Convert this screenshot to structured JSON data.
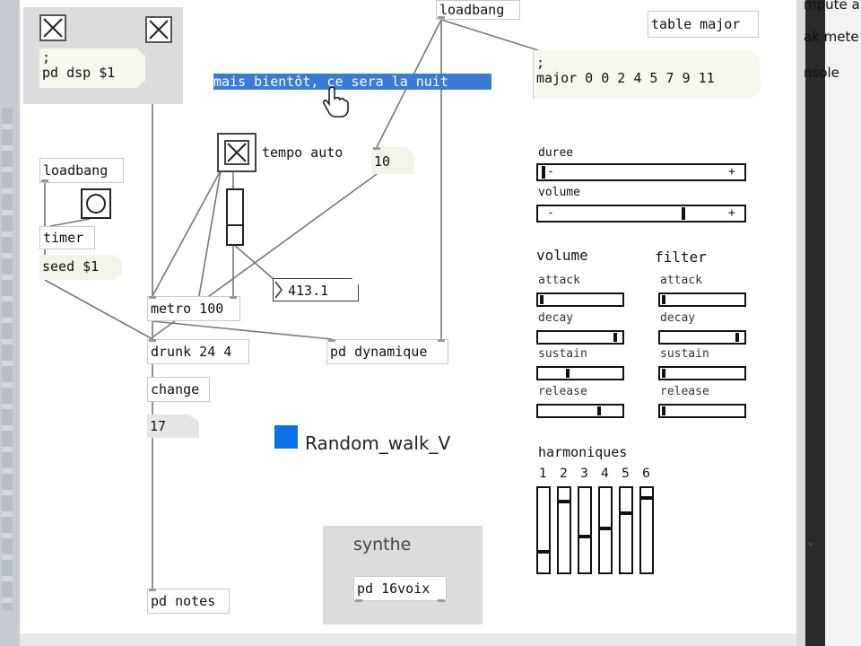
{
  "right_panel": {
    "items": [
      "mpute a",
      "ak mete",
      "nsole"
    ],
    "caret": "⌄"
  },
  "objects": {
    "loadbang_top": "loadbang",
    "table_major": "table major",
    "pd_dsp_msg": ";\npd dsp $1",
    "major_msg": ";\nmajor 0 0 2 4 5 7 9 11",
    "comment_selected": "mais bientôt, ce sera la nuit",
    "tempo_label": "tempo auto",
    "number_10": "10",
    "loadbang_left": "loadbang",
    "timer": "timer",
    "seed": "seed $1",
    "number_4131": "413.1",
    "metro": "metro 100",
    "drunk": "drunk 24 4",
    "pd_dynamique": "pd dynamique",
    "change": "change",
    "number_17": "17",
    "random_walk_label": "Random_walk_V",
    "synthe_label": "synthe",
    "pd_16voix": "pd 16voix",
    "pd_notes": "pd notes"
  },
  "controls": {
    "duree": {
      "label": "duree",
      "minus": "-",
      "plus": "+",
      "value": 0.02
    },
    "volume": {
      "label": "volume",
      "minus": "-",
      "plus": "+",
      "value": 0.7
    },
    "volume_header": "volume",
    "filter_header": "filter",
    "env_volume": [
      {
        "label": "attack",
        "value": 0.02
      },
      {
        "label": "decay",
        "value": 0.95
      },
      {
        "label": "sustain",
        "value": 0.35
      },
      {
        "label": "release",
        "value": 0.75
      }
    ],
    "env_filter": [
      {
        "label": "attack",
        "value": 0.02
      },
      {
        "label": "decay",
        "value": 0.95
      },
      {
        "label": "sustain",
        "value": 0.02
      },
      {
        "label": "release",
        "value": 0.02
      }
    ],
    "harmoniques": {
      "label": "harmoniques",
      "numbers": [
        "1",
        "2",
        "3",
        "4",
        "5",
        "6"
      ],
      "values": [
        0.2,
        0.85,
        0.4,
        0.5,
        0.7,
        0.9
      ]
    }
  },
  "colors": {
    "selection": "#3a7bd5",
    "bang_blue": "#0b72e6",
    "gop_bg": "#dcdcdc"
  }
}
